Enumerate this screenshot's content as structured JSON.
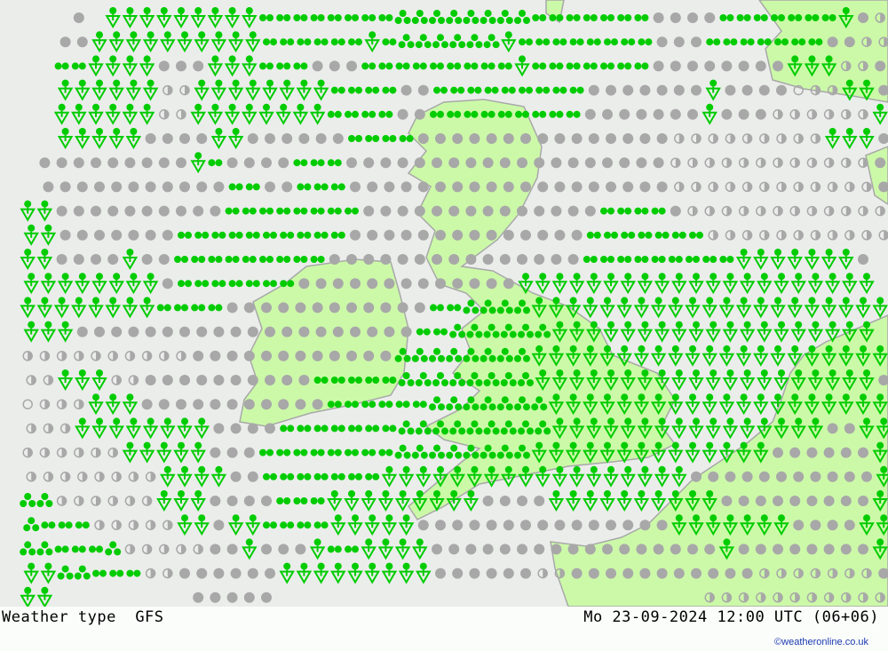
{
  "title": "Weather type",
  "model": "GFS",
  "valid_time": "Mo 23-09-2024 12:00 UTC (06+06)",
  "credit": "©weatheronline.co.uk",
  "colors": {
    "sea": "#ebedeb",
    "land": "#ccf9a8",
    "coast": "#a8a8a8",
    "cloud": "#a8a8a8",
    "precip": "#00cc00"
  },
  "symbol_legend": {
    "c": "overcast",
    "h": "partly-cloudy",
    "o": "clear",
    "d": "drizzle",
    "r": "rain",
    "s": "showers",
    "x": "none"
  },
  "grid_rows": [
    "xxxxcxsssssssssddddddddrrrrrrrrdddddddccccdddddddsch",
    "xxxccssssssssssddddddsdrrrrrrsddddddddcccdddddddcchh",
    "xxxddsssscccsssdddcccdddddddddsdddddddccccccccssshhc",
    "xxxsssssshhssssssssddddccdddddddddcccccccsccccohhssc",
    "xxxsssssshhssssssssddddccdddddddddcccccccsccchhhhhhs",
    "xxxsssssccccssccccccddddccccccccccccccchhhhhhhhhsssc",
    "xxcccccccccsdccccdddccccccccccccccccccchhhhhhhhhhhhc",
    "xxcccccccccccddccdddccccccccccccccccccchhhhhhhhhhhhc",
    "xssccccccccccddddddddccccccccccccccddddchhhhhhhhhhhh",
    "xsscccccccddddddddddccccccccccccccdddddddhhhhhhhhhhh",
    "xssccccsccdddddddddcccccccccccccccdddddddddsssssssc",
    "xsssssssscdddddddcccccccccccccsssssssssssssssssssss",
    "xssssssssddddccccccccccccddrrrrsssssssssssssssssssss",
    "xsssccccccccccccccccccccddrrrrrrsssssssssssssssssss",
    "xhhhhhhhhhhccccccccccccrrrrrrrrsssssssssssssssssssss",
    "xhhssshhccccccccccdddddrrrrrrrrssssssssssssssssssssc",
    "xohhhssscccccccccccddddddrrrrrrrssssssssssssssssssss",
    "xhhhssssssssccccdddddddrrrrrrrrrssssssssssssssssccss",
    "xhhhhhhssssscccddddddddrrrrrrrrssssssssssssssccccccs",
    "xhhhhhhhhssssccdddddddsssssssssssssssssscccccccccccs",
    "xrrhhhhhhsssccccdddsssssssssccccsssssssssscccccccccs",
    "xrdddhhhhhsscssddddssssscccccccccccccccsssssssccccss",
    "xrrdddrhhhhhccscccsddsssscccccccccccccccccsccccccccs",
    "xssrrdddhhccccccssssssssscccccchhccccccccccchhhhhhhc",
    "xssxxxxxxxxcccccxxxxxxxxxxxxxxxxxxxxxxxxxhhhhhhhhhhh"
  ]
}
